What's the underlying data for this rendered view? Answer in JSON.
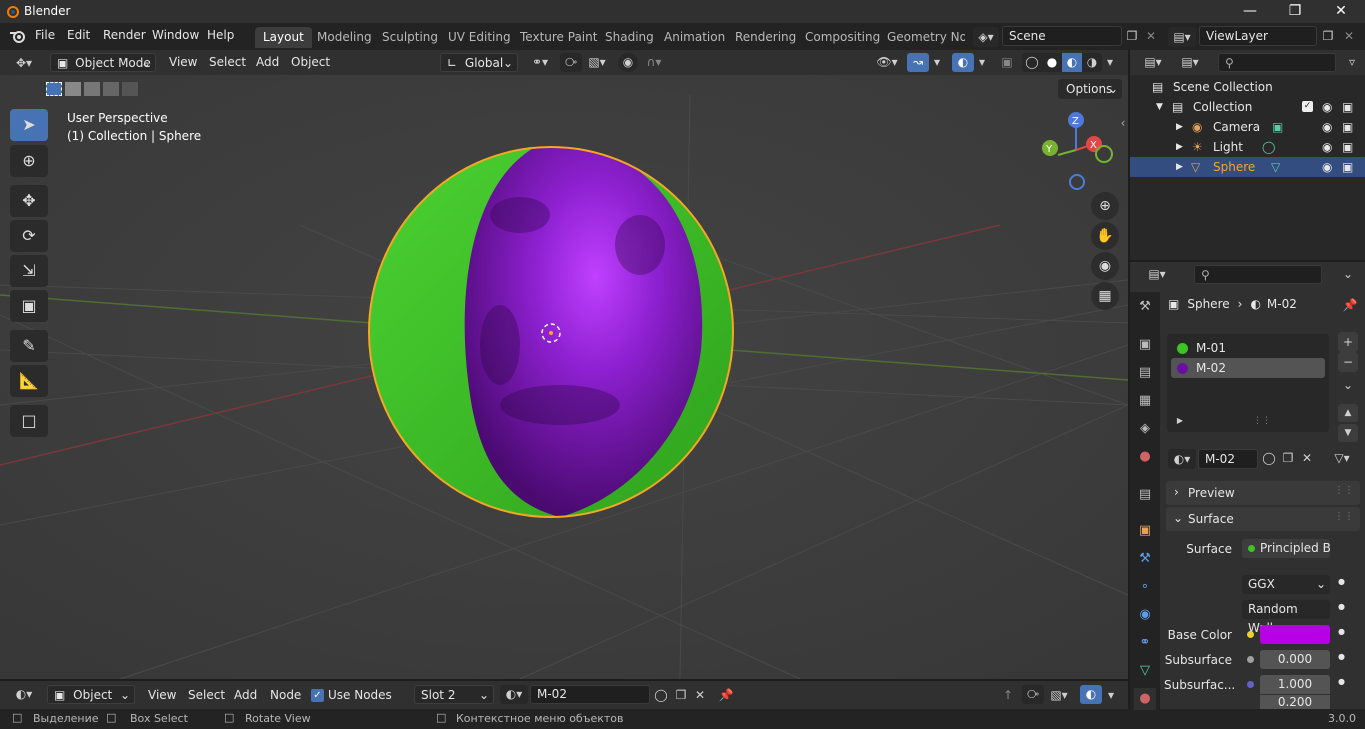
{
  "app": {
    "title": "Blender",
    "version": "3.0.0"
  },
  "menu": [
    "File",
    "Edit",
    "Render",
    "Window",
    "Help"
  ],
  "workspaces": [
    "Layout",
    "Modeling",
    "Sculpting",
    "UV Editing",
    "Texture Paint",
    "Shading",
    "Animation",
    "Rendering",
    "Compositing",
    "Geometry Nod"
  ],
  "active_workspace": "Layout",
  "scene": {
    "name": "Scene",
    "view_layer": "ViewLayer"
  },
  "viewport_header": {
    "mode": "Object Mode",
    "menus": [
      "View",
      "Select",
      "Add",
      "Object"
    ],
    "orientation": "Global",
    "options_label": "Options"
  },
  "viewport": {
    "overlay_line1": "User Perspective",
    "overlay_line2": "(1) Collection | Sphere",
    "axes": {
      "z": "Z",
      "y": "Y",
      "x": "X"
    }
  },
  "outliner": {
    "root": "Scene Collection",
    "collection": "Collection",
    "items": [
      {
        "label": "Camera",
        "selected": false
      },
      {
        "label": "Light",
        "selected": false
      },
      {
        "label": "Sphere",
        "selected": true
      }
    ]
  },
  "properties": {
    "breadcrumb_object": "Sphere",
    "breadcrumb_material": "M-02",
    "slots": [
      {
        "label": "M-01",
        "color": "#3cc427"
      },
      {
        "label": "M-02",
        "color": "#6a0fa0"
      }
    ],
    "material_name": "M-02",
    "panel_preview": "Preview",
    "panel_surface": "Surface",
    "surface_label": "Surface",
    "surface_value": "Principled B...",
    "distribution": "GGX",
    "subsurface_method": "Random Walk",
    "base_color_label": "Base Color",
    "base_color": "#b800e6",
    "subsurface_label": "Subsurface",
    "subsurface_value": "0.000",
    "subsurface_radius_label": "Subsurfac...",
    "subsurface_radius_1": "1.000",
    "subsurface_radius_2": "0.200"
  },
  "node_header": {
    "editor_type": "Object",
    "menus": [
      "View",
      "Select",
      "Add",
      "Node"
    ],
    "use_nodes_label": "Use Nodes",
    "use_nodes_checked": true,
    "slot": "Slot 2",
    "material": "M-02"
  },
  "statusbar": {
    "left1": "Выделение",
    "left2": "Box Select",
    "left3": "Rotate View",
    "left4": "Контекстное меню объектов"
  },
  "colors": {
    "accent": "#4772b3",
    "selected_row": "#334d80",
    "object_orange": "#f5a623",
    "sphere_green": "#3cc427",
    "sphere_purple": "#8a1fc4"
  }
}
